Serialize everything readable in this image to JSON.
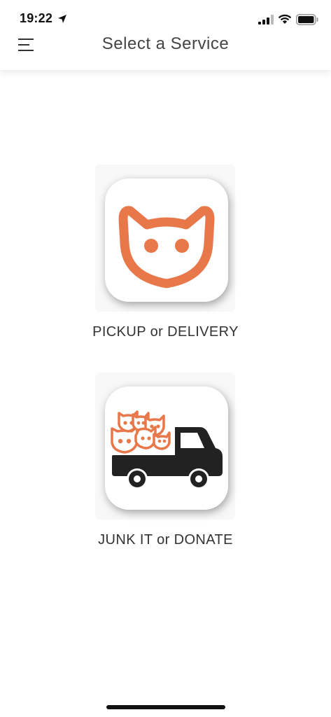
{
  "status_bar": {
    "time": "19:22",
    "icons": [
      "location-arrow-icon",
      "cellular-signal-icon",
      "wifi-icon",
      "battery-icon"
    ]
  },
  "header": {
    "title": "Select a Service",
    "menu_icon": "hamburger-menu-icon"
  },
  "services": [
    {
      "label": "PICKUP or DELIVERY",
      "icon": "cat-face-icon"
    },
    {
      "label": "JUNK IT or DONATE",
      "icon": "truck-with-cats-icon"
    }
  ],
  "colors": {
    "accent": "#E8774A",
    "truck": "#222222",
    "title_text": "#444444",
    "label_text": "#333333"
  }
}
